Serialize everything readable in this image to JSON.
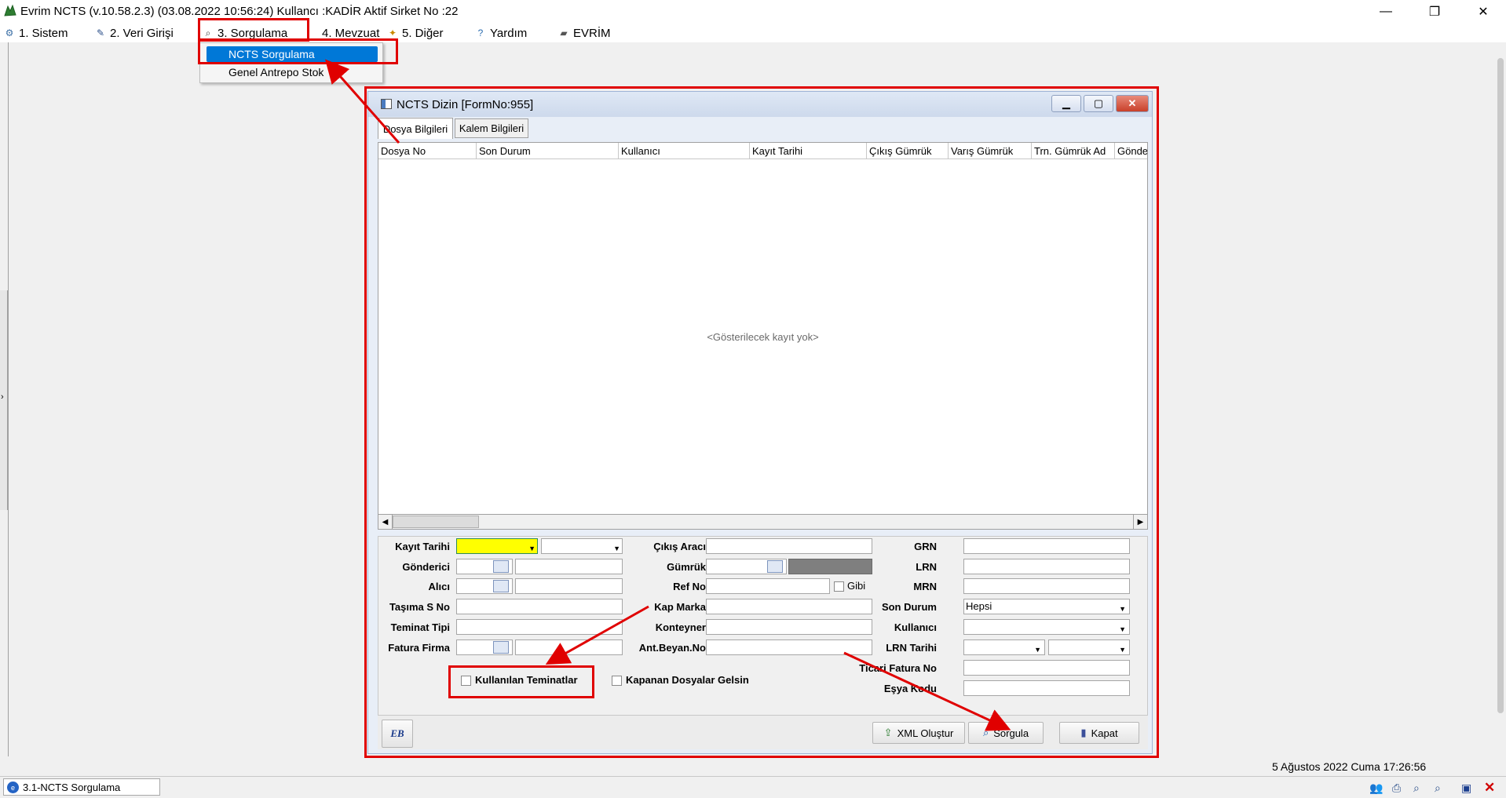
{
  "app": {
    "title": "Evrim NCTS (v.10.58.2.3) (03.08.2022 10:56:24) Kullancı :KADİR Aktif Sirket No :22",
    "minimize_glyph": "—",
    "restore_glyph": "❐",
    "close_glyph": "✕"
  },
  "menu": {
    "items": [
      "1. Sistem",
      "2. Veri Girişi",
      "3. Sorgulama",
      "4. Mevzuat",
      "5. Diğer",
      "Yardım",
      "EVRİM"
    ],
    "dropdown": [
      "NCTS Sorgulama",
      "Genel Antrepo Stok"
    ]
  },
  "form": {
    "title": "NCTS Dizin [FormNo:955]",
    "tabs": [
      "Dosya Bilgileri",
      "Kalem Bilgileri"
    ],
    "columns": [
      "Dosya No",
      "Son Durum",
      "Kullanıcı",
      "Kayıt Tarihi",
      "Çıkış Gümrük",
      "Varış Gümrük",
      "Trn. Gümrük Ad",
      "Gönde"
    ],
    "empty_message": "<Gösterilecek kayıt yok>",
    "labels_left": [
      "Kayıt Tarihi",
      "Gönderici",
      "Alıcı",
      "Taşıma S No",
      "Teminat Tipi",
      "Fatura Firma"
    ],
    "labels_mid": [
      "Çıkış Aracı",
      "Gümrük",
      "Ref No",
      "Kap Marka",
      "Konteyner",
      "Ant.Beyan.No"
    ],
    "labels_right": [
      "GRN",
      "LRN",
      "MRN",
      "Son Durum",
      "Kullanıcı",
      "LRN Tarihi",
      "Ticari Fatura No",
      "Eşya Kodu"
    ],
    "gibi_label": "Gibi",
    "son_durum_value": "Hepsi",
    "checkbox_teminat": "Kullanılan Teminatlar",
    "checkbox_kapanan": "Kapanan Dosyalar Gelsin",
    "buttons": {
      "xml": "XML Oluştur",
      "sorgula": "Sorgula",
      "kapat": "Kapat"
    },
    "logo_text": "EB"
  },
  "status": {
    "datetime": "5 Ağustos 2022 Cuma 17:26:56",
    "task": "3.1-NCTS Sorgulama"
  },
  "colors": {
    "highlight": "#0078d7",
    "annotation": "#e00000",
    "required_field": "#ffff00"
  }
}
